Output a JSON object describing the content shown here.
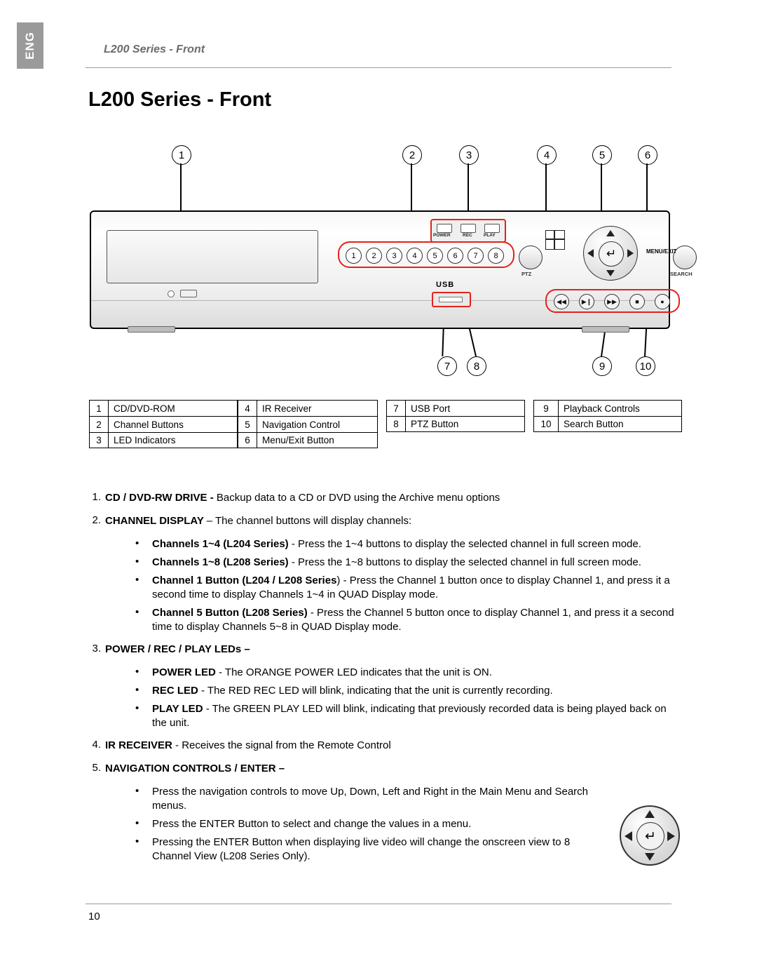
{
  "language_tab": "ENG",
  "header": {
    "running_title": "L200 Series - Front"
  },
  "page_title": "L200 Series - Front",
  "diagram": {
    "callouts": [
      "1",
      "2",
      "3",
      "4",
      "5",
      "6",
      "7",
      "8",
      "9",
      "10"
    ],
    "labels": {
      "usb": "USB",
      "power": "POWER",
      "rec": "REC",
      "play": "PLAY",
      "ptz": "PTZ",
      "search": "SEARCH",
      "menu_exit": "MENU/EXIT"
    },
    "channel_buttons": [
      "1",
      "2",
      "3",
      "4",
      "5",
      "6",
      "7",
      "8"
    ],
    "playback_buttons": [
      "rewind-icon",
      "play-pause-icon",
      "fast-forward-icon",
      "stop-icon",
      "record-icon"
    ],
    "red_highlight_color": "#e2231a"
  },
  "reference_table": {
    "columns": [
      [
        {
          "n": "1",
          "t": "CD/DVD-ROM"
        },
        {
          "n": "2",
          "t": "Channel Buttons"
        },
        {
          "n": "3",
          "t": "LED Indicators"
        }
      ],
      [
        {
          "n": "4",
          "t": "IR Receiver"
        },
        {
          "n": "5",
          "t": "Navigation Control"
        },
        {
          "n": "6",
          "t": "Menu/Exit Button"
        }
      ],
      [
        {
          "n": "7",
          "t": "USB Port"
        },
        {
          "n": "8",
          "t": "PTZ Button"
        }
      ],
      [
        {
          "n": "9",
          "t": "Playback Controls"
        },
        {
          "n": "10",
          "t": "Search Button"
        }
      ]
    ]
  },
  "body": {
    "item1": {
      "num": "1.",
      "bold": "CD / DVD-RW DRIVE - ",
      "rest": "Backup data to a CD or DVD using the Archive menu options"
    },
    "item2": {
      "num": "2.",
      "bold": "CHANNEL DISPLAY ",
      "rest": "– The channel buttons will display channels:",
      "bullets": [
        {
          "bold": "Channels 1~4 (L204 Series)",
          "rest": " - Press the 1~4 buttons to display the selected channel in full screen mode."
        },
        {
          "bold": "Channels 1~8 (L208 Series)",
          "rest": " - Press the 1~8 buttons to display the selected channel in full screen mode."
        },
        {
          "bold": "Channel 1 Button (L204 / L208 Series",
          "rest": ") - Press the Channel 1 button once to display Channel 1, and press it a second time to display Channels 1~4 in QUAD Display mode."
        },
        {
          "bold": "Channel 5 Button (L208 Series)",
          "rest": " - Press the Channel 5 button once to display Channel 1, and press it a second time to display Channels 5~8 in QUAD Display mode."
        }
      ]
    },
    "item3": {
      "num": "3.",
      "heading": "POWER / REC / PLAY LEDs –",
      "bullets": [
        {
          "bold": "POWER LED",
          "rest": " - The ORANGE POWER LED indicates that the unit is ON."
        },
        {
          "bold": "REC LED",
          "rest": " - The RED REC LED will blink, indicating that the unit is currently recording."
        },
        {
          "bold": "PLAY LED",
          "rest": " - The GREEN PLAY LED will blink, indicating that previously recorded data is being played back on the unit."
        }
      ]
    },
    "item4": {
      "num": "4.",
      "bold": "IR RECEIVER",
      "rest": " - Receives the signal from the Remote Control"
    },
    "item5": {
      "num": "5.",
      "heading": "NAVIGATION CONTROLS / ENTER –",
      "bullets": [
        {
          "bold": "",
          "rest": "Press the navigation controls to move Up, Down, Left and Right in the Main Menu and Search menus."
        },
        {
          "bold": "",
          "rest": "Press the ENTER Button to select and change the values in a menu."
        },
        {
          "bold": "",
          "rest": "Pressing the ENTER Button when displaying live video will change the onscreen view to 8 Channel View (L208 Series Only)."
        }
      ]
    }
  },
  "footer": {
    "page_number": "10"
  }
}
